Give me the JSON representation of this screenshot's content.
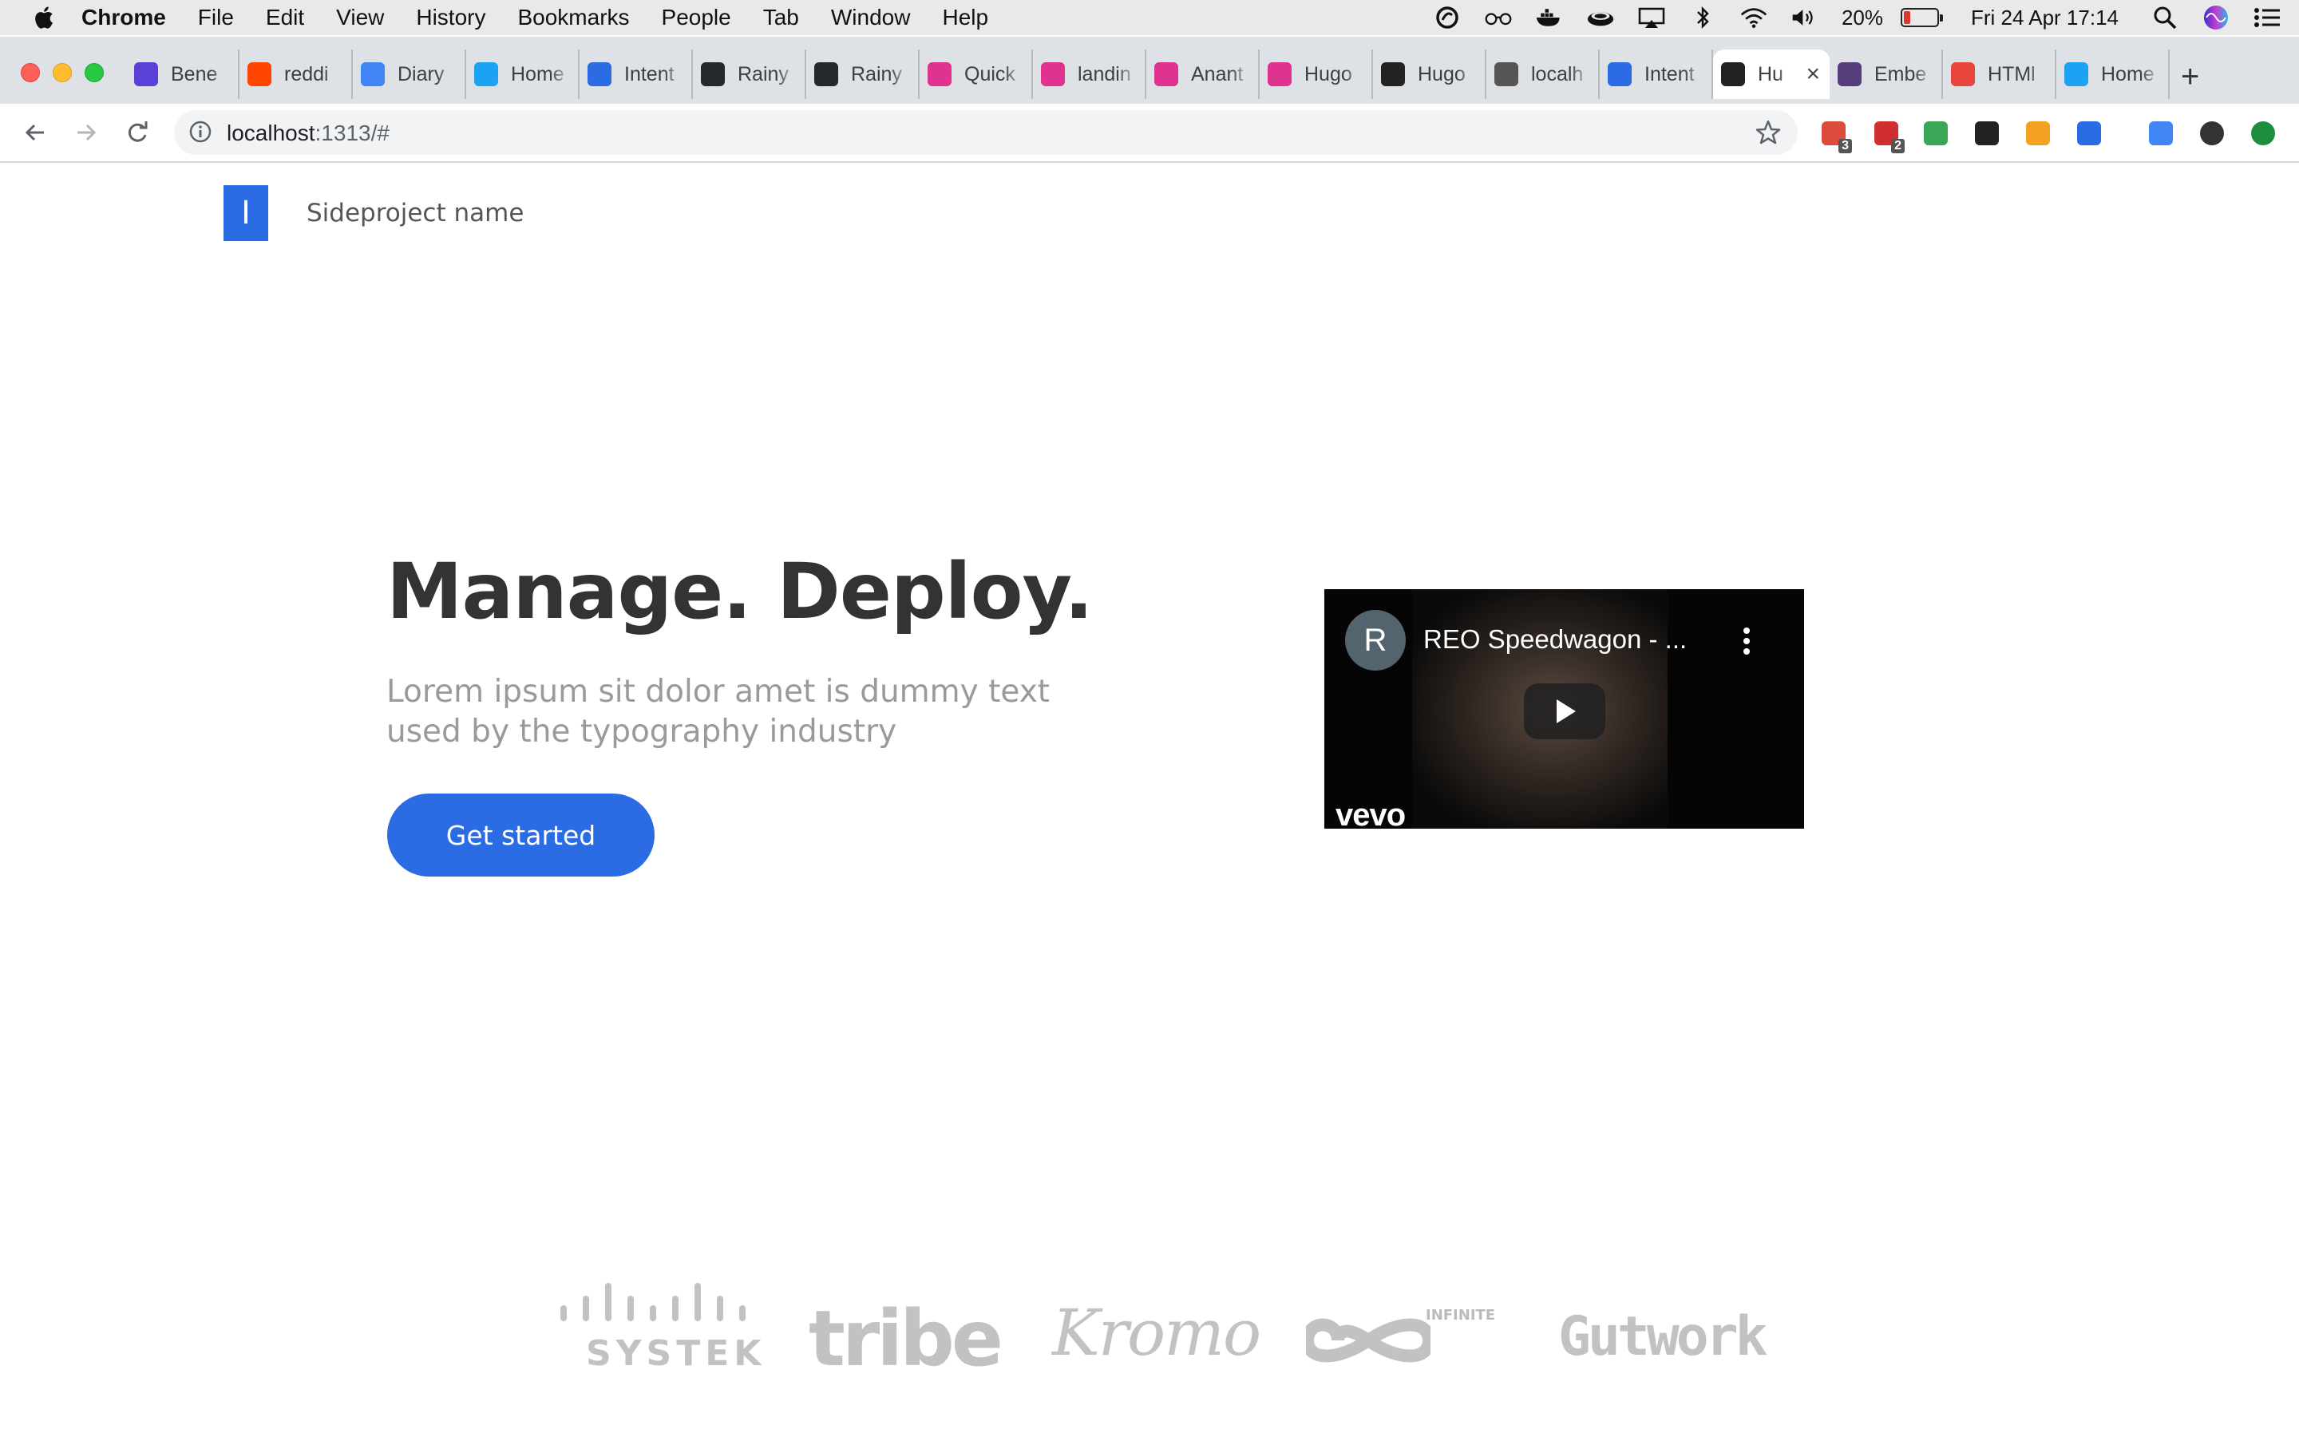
{
  "menubar": {
    "app_name": "Chrome",
    "items": [
      "File",
      "Edit",
      "View",
      "History",
      "Bookmarks",
      "People",
      "Tab",
      "Window",
      "Help"
    ],
    "battery_percent": "20%",
    "battery_level": 0.2,
    "datetime": "Fri 24 Apr  17:14",
    "status_icons": [
      "sync-icon",
      "glasses-icon",
      "docker-icon",
      "coffee-cup-icon",
      "airplay-icon",
      "bluetooth-icon",
      "wifi-icon",
      "volume-icon",
      "battery-icon",
      "spotlight-search-icon",
      "siri-icon",
      "notification-center-icon"
    ]
  },
  "browser": {
    "tabs": [
      {
        "title": "Bene",
        "icon": "s-logo-icon",
        "color": "#5b3fd9"
      },
      {
        "title": "reddi",
        "icon": "reddit-icon",
        "color": "#ff4500"
      },
      {
        "title": "Diary",
        "icon": "google-docs-icon",
        "color": "#4285f4"
      },
      {
        "title": "Home",
        "icon": "twitter-icon",
        "color": "#1da1f2"
      },
      {
        "title": "Intent",
        "icon": "i-logo-icon",
        "color": "#2b6be4"
      },
      {
        "title": "Rainy",
        "icon": "github-icon",
        "color": "#24292e"
      },
      {
        "title": "Rainy",
        "icon": "github-icon",
        "color": "#24292e"
      },
      {
        "title": "Quick",
        "icon": "hugo-icon",
        "color": "#e0338f"
      },
      {
        "title": "landin",
        "icon": "hugo-icon",
        "color": "#e0338f"
      },
      {
        "title": "Anant",
        "icon": "hugo-icon",
        "color": "#e0338f"
      },
      {
        "title": "Hugo",
        "icon": "hugo-icon",
        "color": "#e0338f"
      },
      {
        "title": "Hugo",
        "icon": "hugo-themes-icon",
        "color": "#222"
      },
      {
        "title": "localh",
        "icon": "globe-icon",
        "color": "#555"
      },
      {
        "title": "Intent",
        "icon": "i-logo-icon",
        "color": "#2b6be4"
      },
      {
        "title": "Hu",
        "icon": "hugo-themes-icon",
        "color": "#222",
        "active": true
      },
      {
        "title": "Embe",
        "icon": "bootstrap-icon",
        "color": "#563d7c"
      },
      {
        "title": "HTMl",
        "icon": "color-wheel-icon",
        "color": "#e8453c"
      },
      {
        "title": "Home",
        "icon": "twitter-icon",
        "color": "#1da1f2"
      }
    ],
    "url_host": "localhost",
    "url_rest": ":1313/#",
    "extensions": [
      {
        "name": "todoist-extension-icon",
        "badge": "3",
        "color": "#db4c3f"
      },
      {
        "name": "adblock-extension-icon",
        "badge": "2",
        "color": "#d02f2f"
      },
      {
        "name": "ghostery-extension-icon",
        "badge": "",
        "color": "#3aa757"
      },
      {
        "name": "font-finder-extension-icon",
        "badge": "",
        "color": "#222"
      },
      {
        "name": "wallet-extension-icon",
        "badge": "",
        "color": "#f4a020"
      },
      {
        "name": "intent-extension-icon",
        "badge": "",
        "color": "#2b6be4"
      },
      {
        "name": "cast-extension-icon",
        "badge": "",
        "color": "#4285f4"
      },
      {
        "name": "profile-avatar-icon",
        "badge": "",
        "color": "#333"
      },
      {
        "name": "update-icon",
        "badge": "",
        "color": "#1e8e3e"
      }
    ]
  },
  "page": {
    "logo_letter": "I",
    "brand": "Sideproject name",
    "hero_title": "Manage. Deploy.",
    "hero_subtitle": "Lorem ipsum sit dolor amet is dummy text used by the typography industry",
    "cta_label": "Get started",
    "video": {
      "channel_initial": "R",
      "title": "REO Speedwagon - ...",
      "watermark": "vevo"
    },
    "client_logos": [
      "SYSTEK",
      "tribe",
      "Kromo",
      "INFINITE",
      "Gutwork"
    ]
  },
  "colors": {
    "accent": "#2b6be4",
    "muted_text": "#9a9a9a",
    "logo_gray": "#c2c2c2"
  }
}
